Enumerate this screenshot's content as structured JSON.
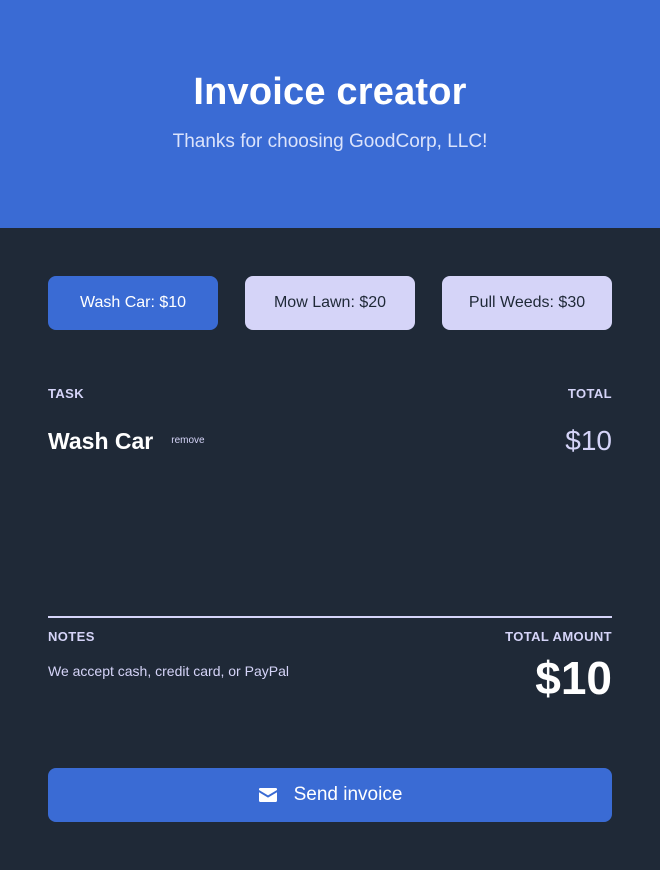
{
  "header": {
    "title": "Invoice creator",
    "subtitle": "Thanks for choosing GoodCorp, LLC!"
  },
  "task_buttons": [
    {
      "label": "Wash Car: $10",
      "active": true
    },
    {
      "label": "Mow Lawn: $20",
      "active": false
    },
    {
      "label": "Pull Weeds: $30",
      "active": false
    }
  ],
  "table": {
    "task_header": "TASK",
    "total_header": "TOTAL",
    "items": [
      {
        "name": "Wash Car",
        "remove_label": "remove",
        "total": "$10"
      }
    ]
  },
  "summary": {
    "notes_header": "NOTES",
    "total_amount_header": "TOTAL AMOUNT",
    "notes_text": "We accept cash, credit card, or PayPal",
    "total_amount": "$10"
  },
  "send_button": {
    "label": "Send invoice",
    "icon": "envelope-icon"
  },
  "colors": {
    "primary": "#3a6bd4",
    "background": "#1f2937",
    "light_accent": "#d5d4f8",
    "text_white": "#ffffff"
  }
}
